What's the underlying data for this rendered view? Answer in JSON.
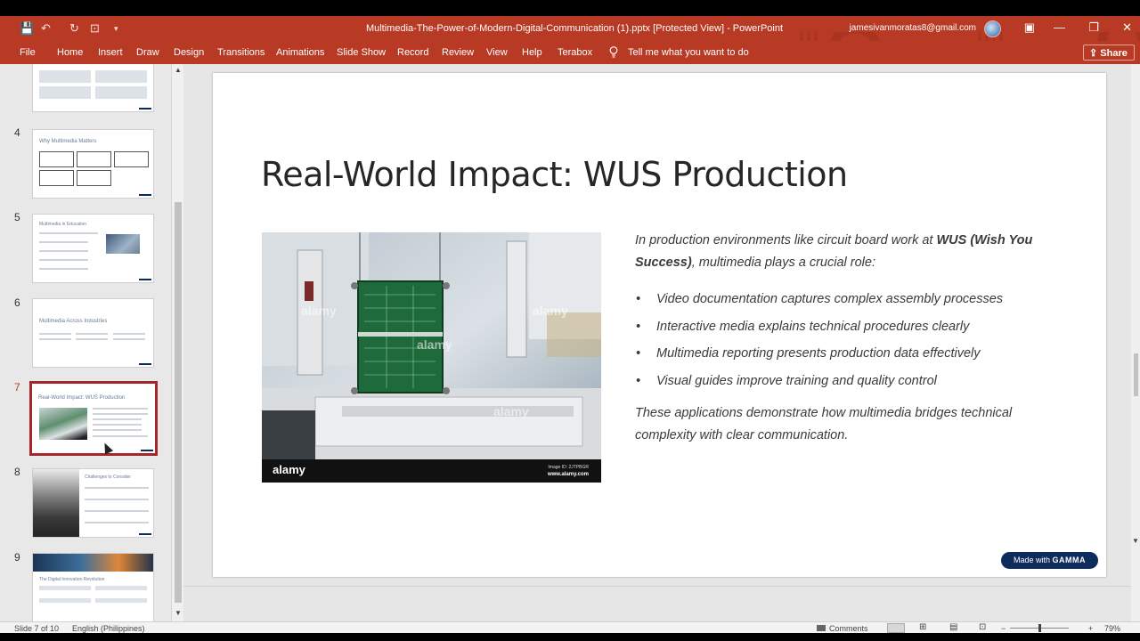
{
  "window": {
    "title": "Multimedia-The-Power-of-Modern-Digital-Communication (1).pptx [Protected View]  -  PowerPoint",
    "account_email": "jamesivanmoratas8@gmail.com",
    "quick_access": {
      "save_icon": "💾",
      "undo_icon": "↶",
      "redo_icon": "↻",
      "present_icon": "⊡",
      "customize_icon": "▾"
    },
    "controls": {
      "ribbon_display": "▣",
      "minimize": "—",
      "restore": "❐",
      "close": "✕"
    }
  },
  "ribbon": {
    "tabs": [
      "File",
      "Home",
      "Insert",
      "Draw",
      "Design",
      "Transitions",
      "Animations",
      "Slide Show",
      "Record",
      "Review",
      "View",
      "Help",
      "Terabox"
    ],
    "tell_me": "Tell me what you want to do",
    "share": "Share",
    "share_caret": "⌄"
  },
  "thumbnails": {
    "scroll_up": "▲",
    "scroll_down": "▼",
    "items": [
      {
        "number": "4",
        "title": "Why Multimedia Matters"
      },
      {
        "number": "5",
        "title": "Multimedia in Education"
      },
      {
        "number": "6",
        "title": "Multimedia Across Industries"
      },
      {
        "number": "7",
        "title": "Real-World Impact: WUS Production"
      },
      {
        "number": "8",
        "title": "Challenges to Consider"
      },
      {
        "number": "9",
        "title": "The Digital Innovation Revolution"
      }
    ]
  },
  "slide": {
    "title": "Real-World Impact: WUS Production",
    "intro_pre": "In production environments like circuit board work at ",
    "intro_bold": "WUS (Wish You Success)",
    "intro_post": ", multimedia plays a crucial role:",
    "bullet_char": "•",
    "bullets": [
      "Video documentation captures complex assembly processes",
      "Interactive media explains technical procedures clearly",
      "Multimedia reporting presents production data effectively",
      "Visual guides improve training and quality control"
    ],
    "outro": "These applications demonstrate how multimedia bridges technical complexity with clear communication.",
    "photo": {
      "brand": "alamy",
      "watermark": "alamy",
      "image_id": "Image ID: 2JTPBGR",
      "site": "www.alamy.com"
    },
    "badge": {
      "prefix": "Made with ",
      "brand": "GAMMA"
    }
  },
  "status": {
    "slide_of": "Slide 7 of 10",
    "language": "English (Philippines)",
    "comments": "Comments",
    "zoom": "79%",
    "zoom_minus": "−",
    "zoom_plus": "+"
  }
}
